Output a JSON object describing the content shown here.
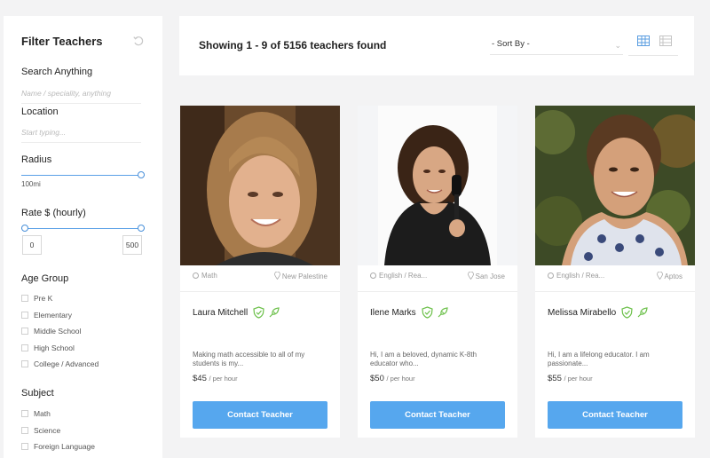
{
  "sidebar": {
    "title": "Filter Teachers",
    "search": {
      "label": "Search Anything",
      "placeholder": "Name / speciality, anything"
    },
    "location": {
      "label": "Location",
      "placeholder": "Start typing..."
    },
    "radius": {
      "label": "Radius",
      "value": "100mi"
    },
    "rate": {
      "label": "Rate $ (hourly)",
      "min": "0",
      "max": "500"
    },
    "age_group": {
      "label": "Age Group",
      "options": [
        "Pre K",
        "Elementary",
        "Middle School",
        "High School",
        "College / Advanced"
      ]
    },
    "subject": {
      "label": "Subject",
      "options": [
        "Math",
        "Science",
        "Foreign Language"
      ]
    }
  },
  "header": {
    "results": "Showing 1 - 9 of 5156 teachers found",
    "sort_label": "- Sort By -"
  },
  "teachers": [
    {
      "subject": "Math",
      "location": "New Palestine",
      "name": "Laura Mitchell",
      "desc": "Making math accessible to all of my students is my...",
      "price": "$45",
      "per": "/ per hour",
      "cta": "Contact Teacher"
    },
    {
      "subject": "English / Rea...",
      "location": "San Jose",
      "name": "Ilene Marks",
      "desc": "Hi, I am a beloved, dynamic K-8th educator who...",
      "price": "$50",
      "per": "/ per hour",
      "cta": "Contact Teacher"
    },
    {
      "subject": "English / Rea...",
      "location": "Aptos",
      "name": "Melissa Mirabello",
      "desc": "Hi, I am a lifelong educator. I am passionate...",
      "price": "$55",
      "per": "/ per hour",
      "cta": "Contact Teacher"
    }
  ],
  "colors": {
    "accent": "#56a7ee",
    "verified": "#6cc04a"
  }
}
